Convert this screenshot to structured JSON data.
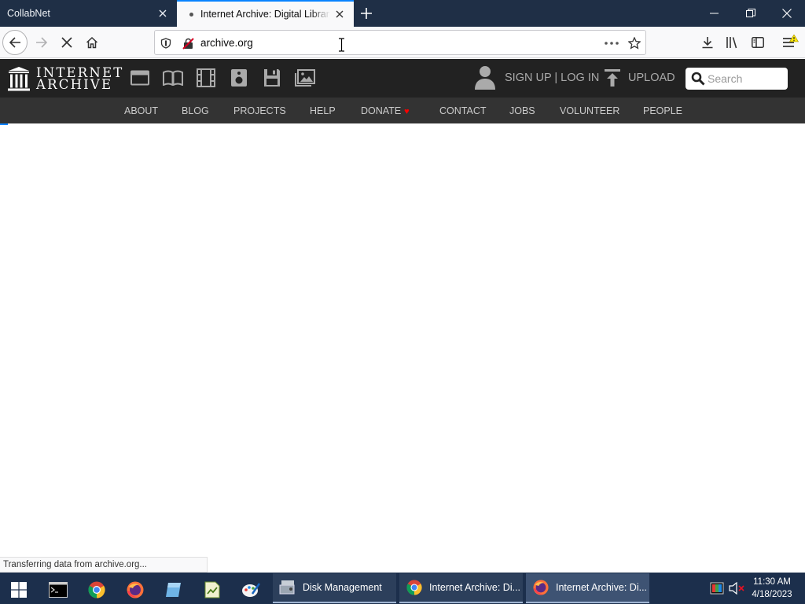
{
  "browser": {
    "tabs": [
      {
        "title": "CollabNet",
        "state": "inactive"
      },
      {
        "title": "Internet Archive: Digital Library",
        "state": "active",
        "loading": true
      }
    ],
    "url": "archive.org",
    "status_text": "Transferring data from archive.org...",
    "accent_color": "#0a84ff",
    "tabstrip_color": "#1f2f46"
  },
  "archive": {
    "logo_line1": "INTERNET",
    "logo_line2": "ARCHIVE",
    "media_icons": [
      "web-icon",
      "texts-icon",
      "video-icon",
      "audio-icon",
      "software-icon",
      "images-icon"
    ],
    "signup": "SIGN UP | LOG IN",
    "upload": "UPLOAD",
    "search_placeholder": "Search",
    "subnav": [
      "ABOUT",
      "BLOG",
      "PROJECTS",
      "HELP",
      "DONATE",
      "CONTACT",
      "JOBS",
      "VOLUNTEER",
      "PEOPLE"
    ],
    "donate_heart_color": "#ff0000"
  },
  "taskbar": {
    "apps": [
      {
        "label": "Disk Management",
        "state": "running"
      },
      {
        "label": "Internet Archive: Di...",
        "state": "running",
        "icon": "chrome-icon"
      },
      {
        "label": "Internet Archive: Di...",
        "state": "active",
        "icon": "firefox-icon"
      }
    ],
    "clock_time": "11:30 AM",
    "clock_date": "4/18/2023"
  }
}
